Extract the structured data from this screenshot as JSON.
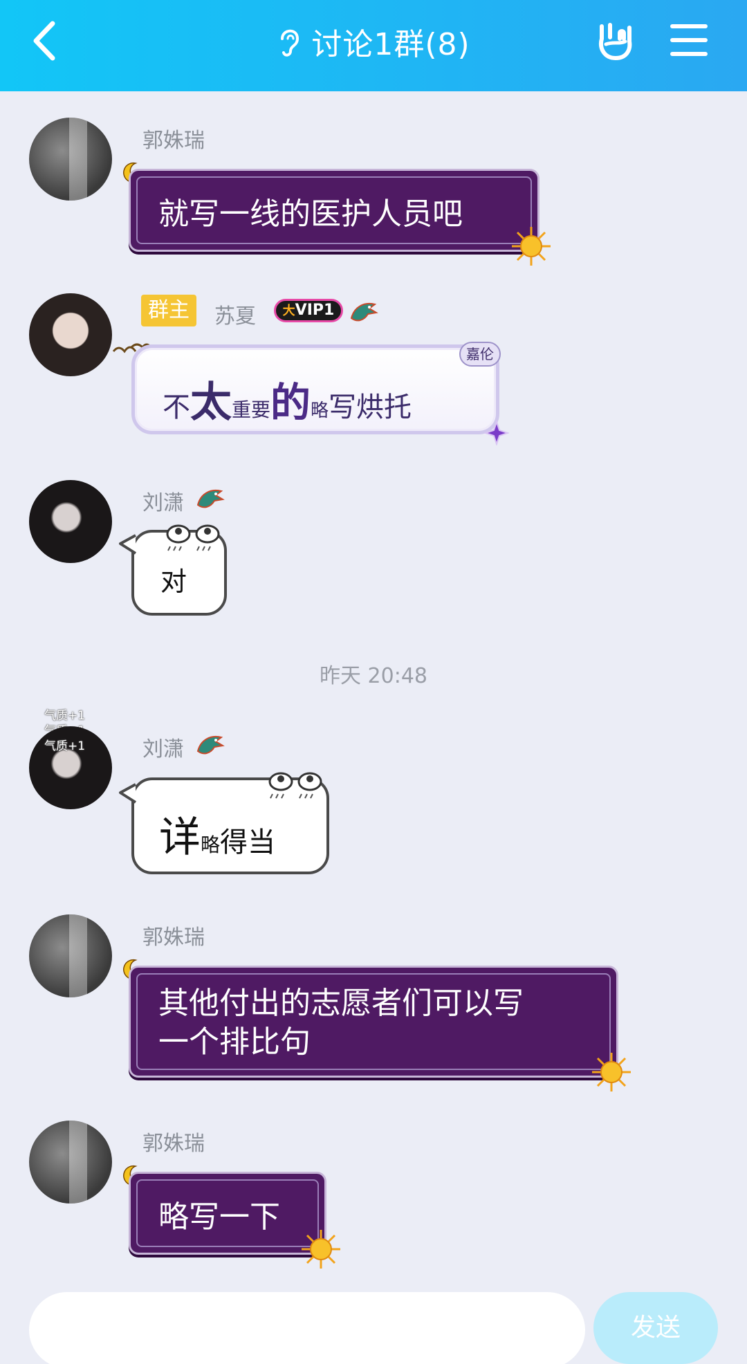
{
  "header": {
    "title": "讨论1群(8)",
    "back_icon": "chevron-left-icon",
    "ear_icon": "ear-icon",
    "hand_icon": "rock-hand-icon",
    "menu_icon": "hamburger-menu-icon"
  },
  "messages": [
    {
      "sender": "郭姝瑞",
      "text": "就写一线的医护人员吧"
    },
    {
      "sender": "苏夏",
      "badge": "群主",
      "vip": "VIP1",
      "vip_prefix": "大",
      "bubble_tag": "嘉伦",
      "parts": [
        "不",
        "太",
        "重要",
        "的",
        "略",
        "写烘托"
      ]
    },
    {
      "sender": "刘潇",
      "text": "对"
    }
  ],
  "timestamp": "昨天 20:48",
  "messages_after": [
    {
      "sender": "刘潇",
      "effects": [
        "气质+1",
        "气质+1",
        "气质+1"
      ],
      "parts": [
        "详",
        "略",
        "得当"
      ]
    },
    {
      "sender": "郭姝瑞",
      "text_line1": "其他付出的志愿者们可以写",
      "text_line2": "一个排比句"
    },
    {
      "sender": "郭姝瑞",
      "text": "略写一下"
    }
  ],
  "input": {
    "placeholder": "",
    "send_label": "发送"
  },
  "colors": {
    "header": "#1fb6f4",
    "background": "#ebedf6",
    "purple_bubble": "#4f1a63",
    "owner_badge": "#f5c534",
    "send_button": "#b9ecfb"
  }
}
